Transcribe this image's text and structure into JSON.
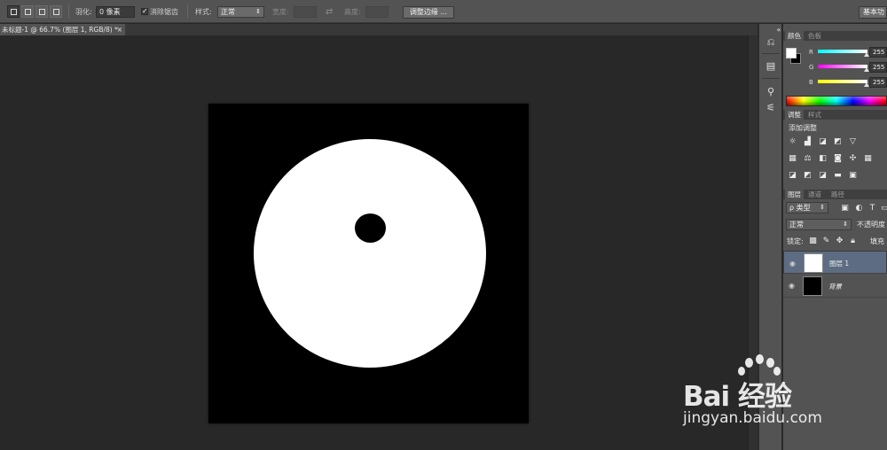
{
  "options_bar": {
    "feather_label": "羽化:",
    "feather_value": "0 像素",
    "antialias_label": "消除锯齿",
    "antialias_checked": true,
    "style_label": "样式:",
    "style_value": "正常",
    "width_label": "宽度:",
    "height_label": "高度:",
    "refine_edge_button": "调整边缘 ...",
    "workspace_button": "基本功"
  },
  "document_tab": {
    "title": "未标题-1 @ 66.7% (图层 1, RGB/8) *",
    "close": "×"
  },
  "color_panel": {
    "tabs": [
      "颜色",
      "色板"
    ],
    "channels": [
      {
        "label": "R",
        "value": "255"
      },
      {
        "label": "G",
        "value": "255"
      },
      {
        "label": "B",
        "value": "255"
      }
    ],
    "foreground": "#ffffff",
    "background": "#000000"
  },
  "adjustments_panel": {
    "tabs": [
      "调整",
      "样式"
    ],
    "heading": "添加调整"
  },
  "layers_panel": {
    "tabs": [
      "图层",
      "通道",
      "路径"
    ],
    "filter_kind": "ρ 类型",
    "blend_mode": "正常",
    "opacity_label": "不透明度",
    "lock_label": "锁定:",
    "fill_label": "填充",
    "layers": [
      {
        "name": "图层 1",
        "selected": true
      },
      {
        "name": "背景",
        "selected": false
      }
    ]
  },
  "watermark": {
    "logo_text": "Bai 经验",
    "url": "jingyan.baidu.com"
  }
}
